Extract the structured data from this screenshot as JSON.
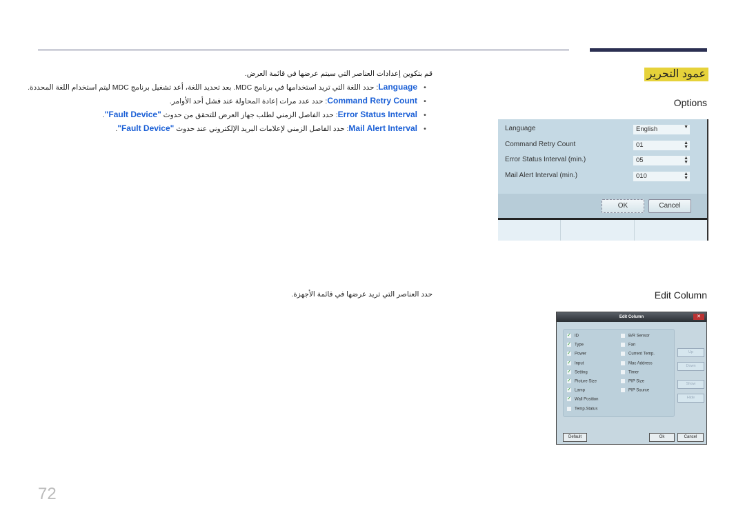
{
  "page": {
    "heading": "عمود التحرير",
    "page_number": "72"
  },
  "options": {
    "section_title": "Options",
    "intro": "قم بتكوين إعدادات العناصر التي سيتم عرضها في قائمة العرض.",
    "items": [
      {
        "term": "Language",
        "text": ": حدد اللغة التي تريد استخدامها في برنامج MDC. بعد تحديد اللغة، أعد تشغيل برنامج MDC ليتم استخدام اللغة المحددة."
      },
      {
        "term": "Command Retry Count",
        "text": ": حدد عدد مرات إعادة المحاولة عند فشل أحد الأوامر."
      },
      {
        "term": "Error Status Interval",
        "text": ": حدد الفاصل الزمني لطلب جهاز العرض للتحقق من حدوث ",
        "quote": "\"Fault Device\"",
        "end": "."
      },
      {
        "term": "Mail Alert Interval",
        "text": ": حدد الفاصل الزمني لإعلامات البريد الإلكتروني عند حدوث ",
        "quote": "\"Fault Device\"",
        "end": "."
      }
    ],
    "dialog": {
      "fields": [
        {
          "label": "Language",
          "value": "English",
          "type": "dropdown"
        },
        {
          "label": "Command Retry Count",
          "value": "01",
          "type": "spinner"
        },
        {
          "label": "Error Status Interval (min.)",
          "value": "05",
          "type": "spinner"
        },
        {
          "label": "Mail Alert Interval (min.)",
          "value": "010",
          "type": "spinner"
        }
      ],
      "ok": "OK",
      "cancel": "Cancel"
    }
  },
  "edit_column": {
    "section_title": "Edit Column",
    "intro": "حدد العناصر التي تريد عرضها في قائمة الأجهزة.",
    "dialog": {
      "title": "Edit Column",
      "left": [
        {
          "label": "ID",
          "checked": true
        },
        {
          "label": "Type",
          "checked": true
        },
        {
          "label": "Power",
          "checked": true
        },
        {
          "label": "Input",
          "checked": true
        },
        {
          "label": "Setting",
          "checked": true
        },
        {
          "label": "Picture Size",
          "checked": true
        },
        {
          "label": "Lamp",
          "checked": true
        },
        {
          "label": "Wall Position",
          "checked": true
        },
        {
          "label": "Temp.Status",
          "checked": false
        }
      ],
      "right": [
        {
          "label": "B/R Sensor",
          "checked": false
        },
        {
          "label": "Fan",
          "checked": false
        },
        {
          "label": "Current Temp.",
          "checked": false
        },
        {
          "label": "Mac Address",
          "checked": false
        },
        {
          "label": "Timer",
          "checked": false
        },
        {
          "label": "PIP Size",
          "checked": false
        },
        {
          "label": "PIP Source",
          "checked": false
        }
      ],
      "side_buttons": [
        "Up",
        "Down",
        "Show",
        "Hide"
      ],
      "default": "Default",
      "ok": "Ok",
      "cancel": "Cancel"
    }
  }
}
